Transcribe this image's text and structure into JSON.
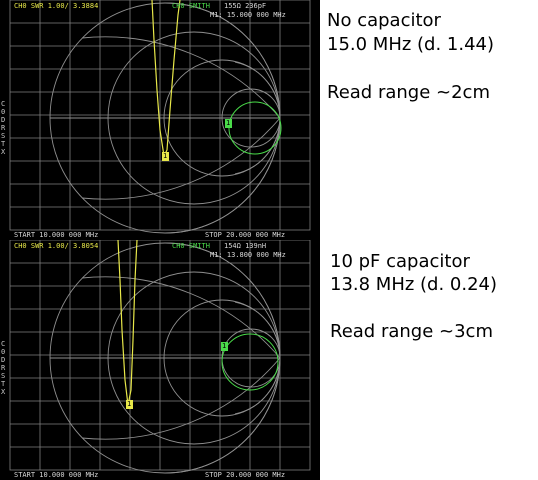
{
  "screens": [
    {
      "id": "top",
      "ch0_swr": "CH0 SWR 1.00/ 3.3884",
      "ch0_smith": "CH0 SMITH",
      "smith_value": "155Ω 236pF",
      "marker_line": "M1: 15.000 000 MHz",
      "side_labels": "C0 D R S T X",
      "start_label": "START 10.000 000 MHz",
      "stop_label": "STOP 20.000 000 MHz",
      "marker_glyph": "1",
      "colors": {
        "swr_trace": "#e8e84a",
        "smith_trace": "#4adc4a",
        "grid": "#8a8a8a"
      }
    },
    {
      "id": "bottom",
      "ch0_swr": "CH0 SWR 1.00/ 3.8054",
      "ch0_smith": "CH0 SMITH",
      "smith_value": "154Ω 139nH",
      "marker_line": "M1: 13.800 000 MHz",
      "side_labels": "C0 D R S T X",
      "start_label": "START 10.000 000 MHz",
      "stop_label": "STOP 20.000 000 MHz",
      "marker_glyph": "1",
      "colors": {
        "swr_trace": "#e8e84a",
        "smith_trace": "#4adc4a",
        "grid": "#8a8a8a"
      }
    }
  ],
  "captions": {
    "top": {
      "line1": "No capacitor",
      "line2": "15.0 MHz (d. 1.44)",
      "line3": "Read range ~2cm"
    },
    "bottom": {
      "line1": "10 pF capacitor",
      "line2": "13.8 MHz (d. 0.24)",
      "line3": "Read range ~3cm"
    }
  }
}
